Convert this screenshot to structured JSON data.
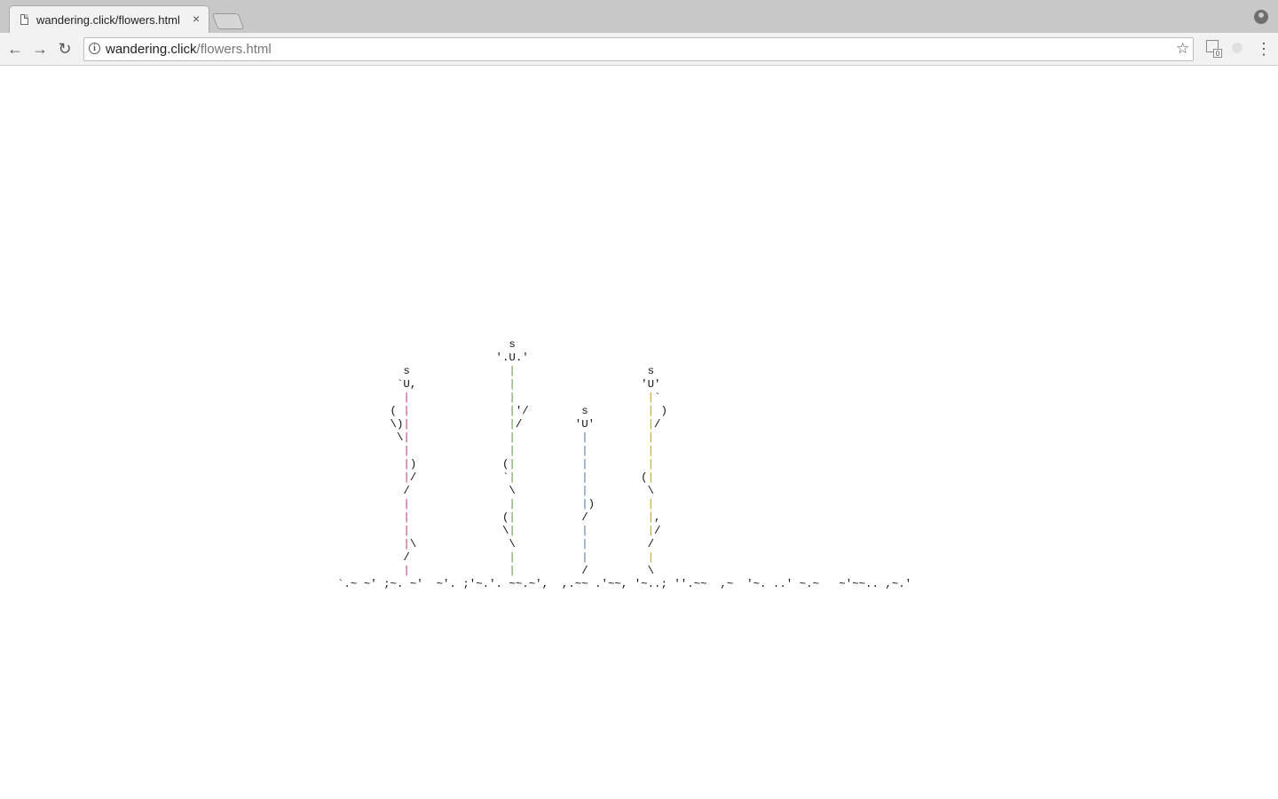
{
  "browser": {
    "tab_title": "wandering.click/flowers.html",
    "tab_close": "×",
    "url_host": "wandering.click",
    "url_path": "/flowers.html",
    "ext_badge": "0",
    "icons": [
      "page-icon",
      "close-icon",
      "new-tab-icon",
      "profile-icon",
      "back-icon",
      "forward-icon",
      "reload-icon",
      "info-icon",
      "star-icon",
      "extension-icon",
      "menu-icon"
    ]
  },
  "garden": {
    "lines": [
      "                          s",
      "                        '.U.'",
      "          s               |                    s",
      "         `U,              |                   'U'",
      "          |               |                    |`",
      "        ( |               |'/        s         | )",
      "        \\)|               |/        'U'        |/",
      "         \\|               |          |         |",
      "          |               |          |         |",
      "          |)             (|          |         |",
      "          |/             `|          |        (|",
      "          /               \\          |         \\",
      "          |               |          |)        |",
      "          |              (|          /         |,",
      "          |              \\|          |         |/",
      "          |\\              \\          |         /",
      "          /               |          |         |",
      "          |               |          /         \\",
      "`.~ ~' ;~. ~'  ~'. ;'~.'. ~~.~',  ,.~~ .'~~, '~..; ''.~~  ,~  '~. ..' ~.~   ~'~~.. ,~.'"
    ]
  }
}
